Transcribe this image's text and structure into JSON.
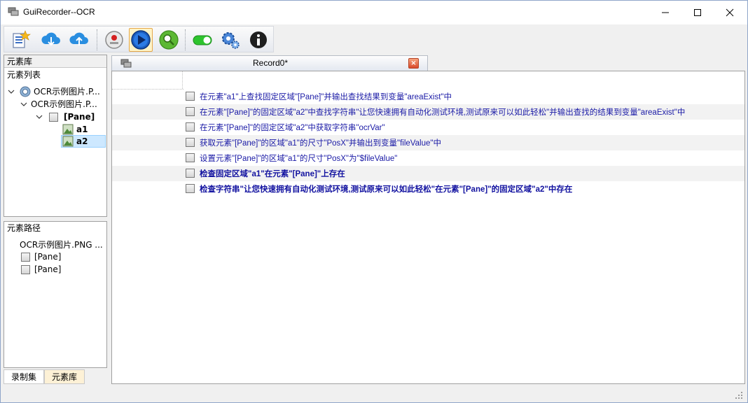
{
  "window": {
    "title": "GuiRecorder--OCR",
    "controls": {
      "minimize": "minimize",
      "maximize": "maximize",
      "close": "close"
    }
  },
  "toolbar": {
    "buttons": [
      {
        "icon": "new-project-icon"
      },
      {
        "icon": "cloud-download-icon"
      },
      {
        "icon": "cloud-upload-icon"
      },
      {
        "icon": "record-icon"
      },
      {
        "icon": "play-icon",
        "active": true
      },
      {
        "icon": "search-icon"
      },
      {
        "icon": "toggle-icon"
      },
      {
        "icon": "settings-icon"
      },
      {
        "icon": "info-icon"
      }
    ]
  },
  "element_library": {
    "header": "元素库",
    "list_label": "元素列表",
    "tree": [
      {
        "label": "OCR示例图片.P...",
        "level": 0,
        "icon": "ocr-image-icon"
      },
      {
        "label": "OCR示例图片.P...",
        "level": 1
      },
      {
        "label": "[Pane]",
        "level": 2,
        "bold": true
      },
      {
        "label": "a1",
        "level": 3,
        "bold": true,
        "icon": "image-region-icon"
      },
      {
        "label": "a2",
        "level": 3,
        "bold": true,
        "icon": "image-region-icon",
        "selected": true
      }
    ]
  },
  "element_path": {
    "header": "元素路径",
    "items": [
      {
        "label": "OCR示例图片.PNG ..."
      },
      {
        "label": "[Pane]"
      },
      {
        "label": "[Pane]"
      }
    ]
  },
  "bottom_tabs": [
    {
      "label": "录制集",
      "active": true
    },
    {
      "label": "元素库",
      "active": false
    }
  ],
  "document": {
    "tab_title": "Record0*",
    "close_glyph": "×",
    "steps": [
      {
        "text": "在元素\"a1\"上查找固定区域\"[Pane]\"并输出查找结果到变量\"areaExist\"中",
        "bold": false
      },
      {
        "text": "在元素\"[Pane]\"的固定区域\"a2\"中查找字符串\"让您快速拥有自动化测试环境,测试原来可以如此轻松\"并输出查找的结果到变量\"areaExist\"中",
        "bold": false
      },
      {
        "text": "在元素\"[Pane]\"的固定区域\"a2\"中获取字符串\"ocrVar\"",
        "bold": false
      },
      {
        "text": "获取元素\"[Pane]\"的区域\"a1\"的尺寸\"PosX\"并输出到变量\"fileValue\"中",
        "bold": false
      },
      {
        "text": "设置元素\"[Pane]\"的区域\"a1\"的尺寸\"PosX\"为\"$fileValue\"",
        "bold": false
      },
      {
        "text": "检查固定区域\"a1\"在元素\"[Pane]\"上存在",
        "bold": true
      },
      {
        "text": "检查字符串\"让您快速拥有自动化测试环境,测试原来可以如此轻松\"在元素\"[Pane]\"的固定区域\"a2\"中存在",
        "bold": true
      }
    ]
  },
  "colors": {
    "step_text": "#1a1aa6",
    "selection": "#cde8ff",
    "close_button": "#d9482a",
    "active_tool": "#fff3c7"
  }
}
